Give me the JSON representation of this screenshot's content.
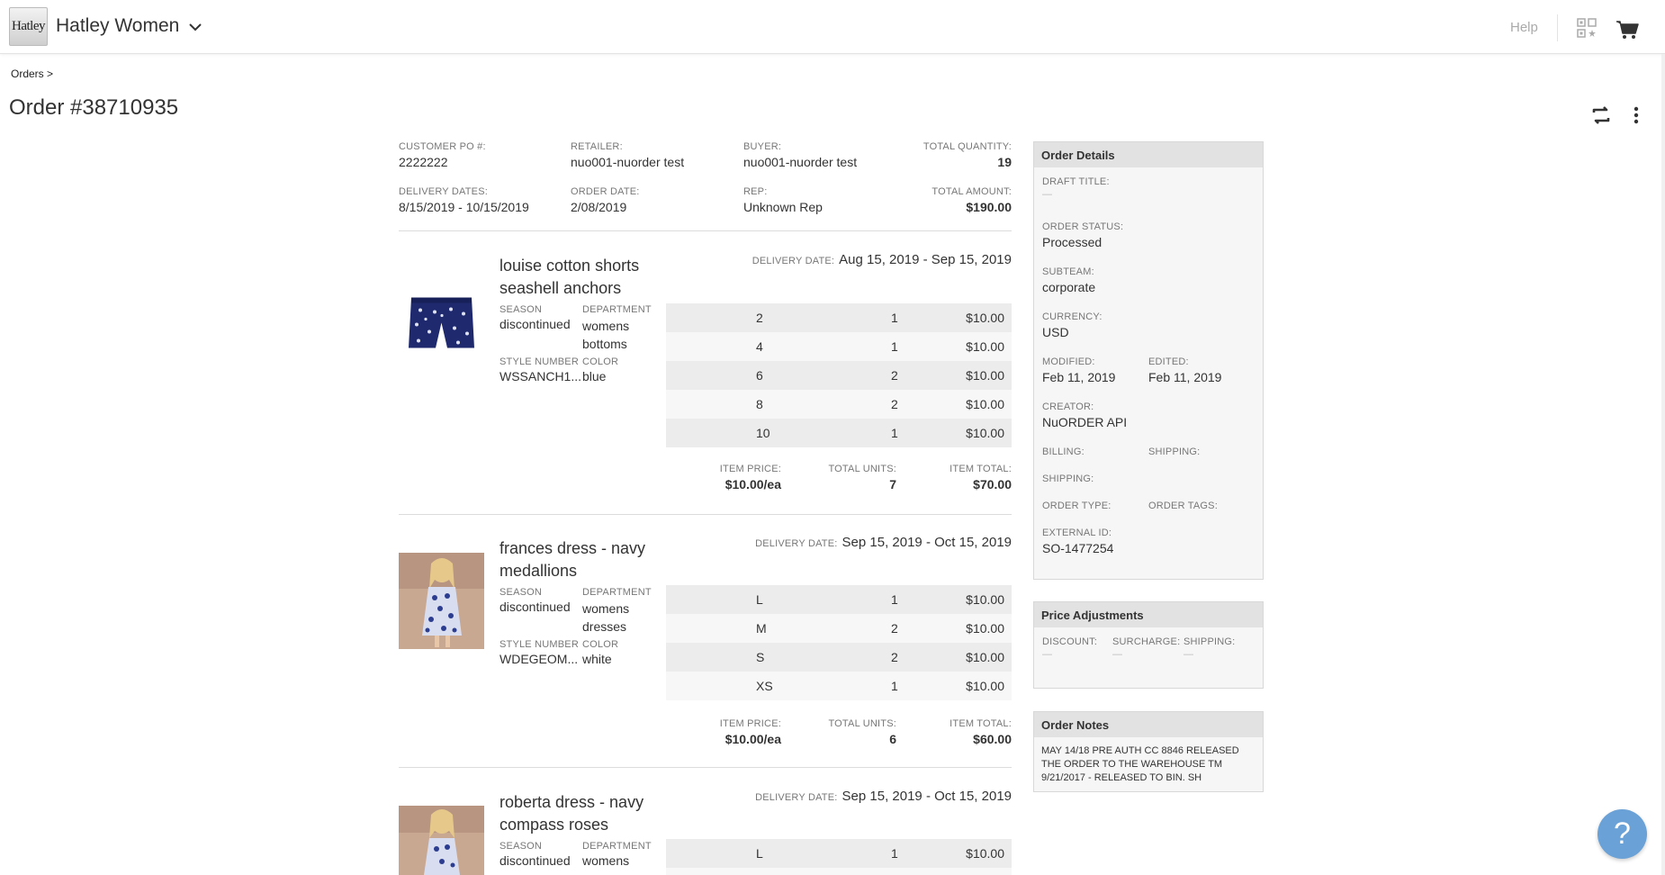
{
  "header": {
    "logo_text": "Hatley",
    "brand": "Hatley Women",
    "help": "Help"
  },
  "breadcrumb": "Orders >",
  "page_title": "Order #38710935",
  "summary": {
    "customer_po_label": "CUSTOMER PO #:",
    "customer_po": "2222222",
    "retailer_label": "RETAILER:",
    "retailer": "nuo001-nuorder test",
    "buyer_label": "BUYER:",
    "buyer": "nuo001-nuorder test",
    "total_quantity_label": "TOTAL QUANTITY:",
    "total_quantity": "19",
    "delivery_dates_label": "DELIVERY DATES:",
    "delivery_dates": "8/15/2019 - 10/15/2019",
    "order_date_label": "ORDER DATE:",
    "order_date": "2/08/2019",
    "rep_label": "REP:",
    "rep": "Unknown Rep",
    "total_amount_label": "TOTAL AMOUNT:",
    "total_amount": "$190.00"
  },
  "labels": {
    "season": "SEASON",
    "department": "DEPARTMENT",
    "style_number": "STYLE NUMBER",
    "color": "COLOR",
    "delivery_date": "DELIVERY DATE:",
    "item_price": "ITEM PRICE:",
    "total_units": "TOTAL UNITS:",
    "item_total": "ITEM TOTAL:"
  },
  "items": [
    {
      "name": "louise cotton shorts seashell anchors",
      "season": "discontinued",
      "department": "womens bottoms",
      "style_number": "WSSANCH1...",
      "color": "blue",
      "delivery_date": "Aug 15, 2019 - Sep 15, 2019",
      "sizes": [
        {
          "size": "2",
          "qty": "1",
          "price": "$10.00"
        },
        {
          "size": "4",
          "qty": "1",
          "price": "$10.00"
        },
        {
          "size": "6",
          "qty": "2",
          "price": "$10.00"
        },
        {
          "size": "8",
          "qty": "2",
          "price": "$10.00"
        },
        {
          "size": "10",
          "qty": "1",
          "price": "$10.00"
        }
      ],
      "item_price": "$10.00/ea",
      "total_units": "7",
      "item_total": "$70.00"
    },
    {
      "name": "frances dress - navy medallions",
      "season": "discontinued",
      "department": "womens dresses",
      "style_number": "WDEGEOM...",
      "color": "white",
      "delivery_date": "Sep 15, 2019 - Oct 15, 2019",
      "sizes": [
        {
          "size": "L",
          "qty": "1",
          "price": "$10.00"
        },
        {
          "size": "M",
          "qty": "2",
          "price": "$10.00"
        },
        {
          "size": "S",
          "qty": "2",
          "price": "$10.00"
        },
        {
          "size": "XS",
          "qty": "1",
          "price": "$10.00"
        }
      ],
      "item_price": "$10.00/ea",
      "total_units": "6",
      "item_total": "$60.00"
    },
    {
      "name": "roberta dress - navy compass roses",
      "season": "discontinued",
      "department": "womens",
      "delivery_date": "Sep 15, 2019 - Oct 15, 2019",
      "sizes": [
        {
          "size": "L",
          "qty": "1",
          "price": "$10.00"
        }
      ]
    }
  ],
  "order_details": {
    "title": "Order Details",
    "draft_title_label": "DRAFT TITLE:",
    "draft_title": "—",
    "order_status_label": "ORDER STATUS:",
    "order_status": "Processed",
    "subteam_label": "SUBTEAM:",
    "subteam": "corporate",
    "currency_label": "CURRENCY:",
    "currency": "USD",
    "modified_label": "MODIFIED:",
    "modified": "Feb 11, 2019",
    "edited_label": "EDITED:",
    "edited": "Feb 11, 2019",
    "creator_label": "CREATOR:",
    "creator": "NuORDER API",
    "billing_label": "BILLING:",
    "shipping_label": "SHIPPING:",
    "shipping2_label": "SHIPPING:",
    "order_type_label": "ORDER TYPE:",
    "order_tags_label": "ORDER TAGS:",
    "external_id_label": "EXTERNAL ID:",
    "external_id": "SO-1477254"
  },
  "price_adjustments": {
    "title": "Price Adjustments",
    "discount_label": "DISCOUNT:",
    "surcharge_label": "SURCHARGE:",
    "shipping_label": "SHIPPING:",
    "discount": "—",
    "surcharge": "—",
    "shipping": "—"
  },
  "order_notes": {
    "title": "Order Notes",
    "text": "MAY 14/18 PRE AUTH CC 8846 RELEASED THE ORDER TO THE WAREHOUSE TM 9/21/2017 - RELEASED TO BIN. SH"
  },
  "help_fab": "?"
}
